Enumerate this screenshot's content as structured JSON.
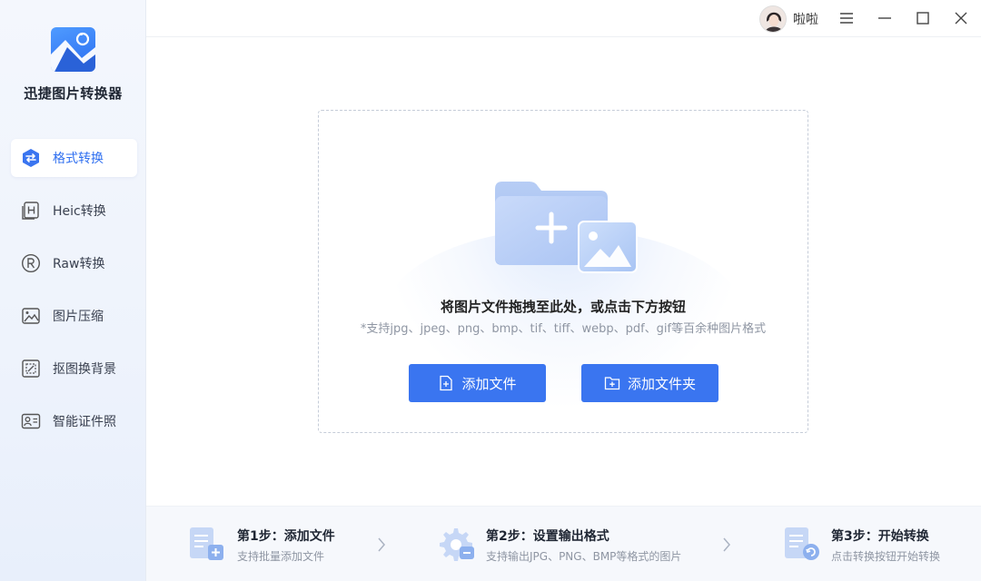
{
  "app": {
    "title": "迅捷图片转换器"
  },
  "sidebar": {
    "items": [
      {
        "label": "格式转换",
        "icon": "format-convert-icon",
        "active": true
      },
      {
        "label": "Heic转换",
        "icon": "heic-icon"
      },
      {
        "label": "Raw转换",
        "icon": "raw-icon"
      },
      {
        "label": "图片压缩",
        "icon": "image-compress-icon"
      },
      {
        "label": "抠图换背景",
        "icon": "cutout-icon"
      },
      {
        "label": "智能证件照",
        "icon": "id-photo-icon"
      }
    ]
  },
  "header": {
    "username": "啦啦"
  },
  "dropzone": {
    "title": "将图片文件拖拽至此处，或点击下方按钮",
    "subtitle": "*支持jpg、jpeg、png、bmp、tif、tiff、webp、pdf、gif等百余种图片格式",
    "add_file_label": "添加文件",
    "add_folder_label": "添加文件夹"
  },
  "steps": [
    {
      "title": "第1步：添加文件",
      "desc": "支持批量添加文件"
    },
    {
      "title": "第2步：设置输出格式",
      "desc": "支持输出JPG、PNG、BMP等格式的图片"
    },
    {
      "title": "第3步：开始转换",
      "desc": "点击转换按钮开始转换"
    }
  ],
  "colors": {
    "accent": "#3a75f0",
    "active_text": "#2f6ff0",
    "sidebar_bg": "#eef3fc"
  }
}
